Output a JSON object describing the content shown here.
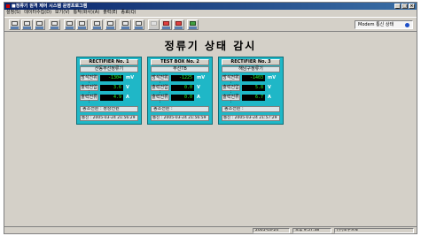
{
  "window": {
    "title": "■정류기 원격 제어 시스템 운영프로그램"
  },
  "menu": [
    "설정(S)",
    "데이터수집(D)",
    "보기(V)",
    "통작(화사)(A)",
    "출력(E)",
    "종료(Q)"
  ],
  "toolbar": {
    "buttons": [
      {
        "name": "tool-1-button",
        "state": "normal"
      },
      {
        "name": "tool-2-button",
        "state": "normal"
      },
      {
        "name": "tool-3-button",
        "state": "normal"
      },
      {
        "name": "tool-4-button",
        "state": "normal"
      },
      {
        "name": "tool-5-button",
        "state": "normal"
      },
      {
        "name": "tool-6-button",
        "state": "normal"
      },
      {
        "name": "tool-7-button",
        "state": "normal"
      },
      {
        "name": "tool-8-button",
        "state": "normal"
      },
      {
        "name": "tool-9-button",
        "state": "normal"
      },
      {
        "name": "tool-10-button",
        "state": "normal"
      },
      {
        "name": "tool-11-button",
        "state": "disabled"
      },
      {
        "name": "tool-12-button",
        "state": "red"
      },
      {
        "name": "tool-13-button",
        "state": "red"
      },
      {
        "name": "tool-14-button",
        "state": "green"
      }
    ],
    "modem_status": "Modem 통신 상태",
    "modem_color": "#1e50c8"
  },
  "page_title": "정류기 상태 감시",
  "panels": [
    {
      "title": "RECTIFIER No. 1",
      "subtitle": "산동부선정류기",
      "rows": [
        {
          "label": "방식전위 :",
          "value": "-1304",
          "unit": "mV"
        },
        {
          "label": "출력전압 :",
          "value": "3.6",
          "unit": "V"
        },
        {
          "label": "출력전류 :",
          "value": "4.9",
          "unit": "A"
        }
      ],
      "status": "동조전원 : 정상전원",
      "comm": "통신 : 2005-03-24 21:56:29"
    },
    {
      "title": "TEST BOX No. 2",
      "subtitle": "무선TB",
      "rows": [
        {
          "label": "방식전위 :",
          "value": "-1225",
          "unit": "mV"
        },
        {
          "label": "출력전압 :",
          "value": "0.0",
          "unit": "V"
        },
        {
          "label": "출력전류 :",
          "value": "0.0",
          "unit": "A"
        }
      ],
      "status": "동조전원 :",
      "comm": "통신 : 2005-03-24 21:56:59"
    },
    {
      "title": "RECTIFIER No. 3",
      "subtitle": "해남구정류기",
      "rows": [
        {
          "label": "방식전위 :",
          "value": "-1403",
          "unit": "mV"
        },
        {
          "label": "출력전압 :",
          "value": "5.8",
          "unit": "V"
        },
        {
          "label": "출력전류 :",
          "value": "6.7",
          "unit": "A"
        }
      ],
      "status": "동조전원 :",
      "comm": "통신 : 2005-03-24 21:57:29"
    }
  ],
  "statusbar": {
    "date": "2005-03-24",
    "text2": "오후 9:57:38",
    "text3": "(주)보우프로"
  }
}
